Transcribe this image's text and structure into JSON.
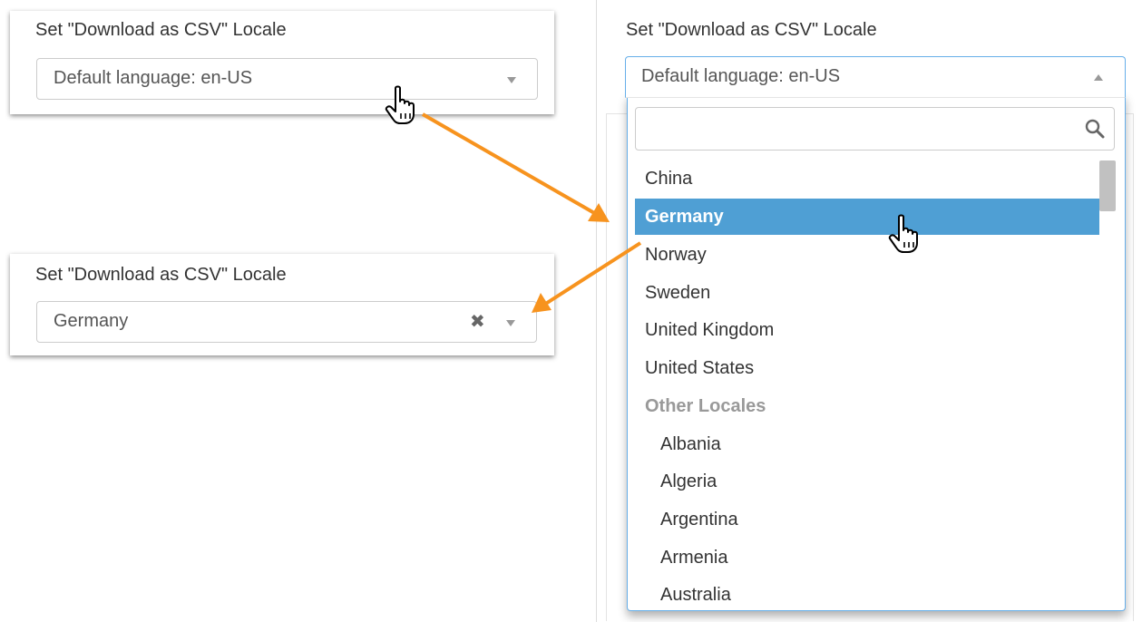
{
  "panel_top_left": {
    "title": "Set \"Download as CSV\" Locale",
    "select_value": "Default language: en-US",
    "arrow_icon": "triangle-down-icon"
  },
  "panel_bottom_left": {
    "title": "Set \"Download as CSV\" Locale",
    "select_value": "Germany",
    "clear_symbol": "✖",
    "arrow_icon": "triangle-down-icon"
  },
  "panel_right": {
    "title": "Set \"Download as CSV\" Locale",
    "select_value": "Default language: en-US",
    "arrow_icon": "triangle-up-icon",
    "search_placeholder": "",
    "search_icon": "search-icon",
    "items": [
      {
        "label": "China",
        "kind": "option"
      },
      {
        "label": "Germany",
        "kind": "highlighted"
      },
      {
        "label": "Norway",
        "kind": "option"
      },
      {
        "label": "Sweden",
        "kind": "option"
      },
      {
        "label": "United Kingdom",
        "kind": "option"
      },
      {
        "label": "United States",
        "kind": "option"
      },
      {
        "label": "Other Locales",
        "kind": "group"
      },
      {
        "label": "Albania",
        "kind": "sub"
      },
      {
        "label": "Algeria",
        "kind": "sub"
      },
      {
        "label": "Argentina",
        "kind": "sub"
      },
      {
        "label": "Armenia",
        "kind": "sub"
      },
      {
        "label": "Australia",
        "kind": "sub"
      }
    ]
  },
  "colors": {
    "highlight": "#4f9fd4",
    "focus_border": "#66afe9",
    "annotation_arrow": "#f7931e",
    "group_label": "#999999"
  }
}
